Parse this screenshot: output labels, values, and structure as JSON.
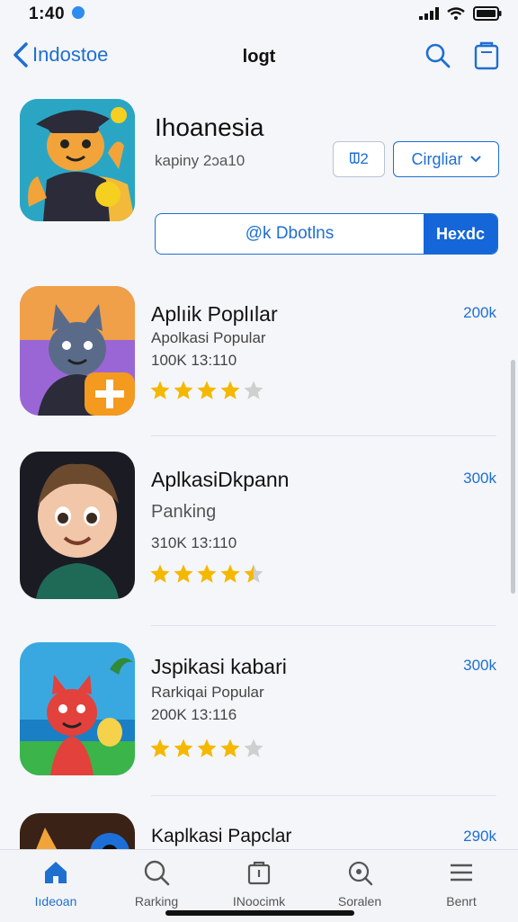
{
  "status": {
    "time": "1:40"
  },
  "nav": {
    "back_label": "Indostoe",
    "title": "loɡt"
  },
  "app": {
    "title": "Ihoanesia",
    "subtitle": "kapiny 2ɔa10",
    "small_button_label": "ᗵ2",
    "dropdown_label": "Cirgliar",
    "wide_button_left_label": "@k Dbotlns",
    "wide_button_right_label": "Hexdc"
  },
  "list": [
    {
      "name": "Aplıik Poplılar",
      "subtitle": "Apolkasi Popular",
      "meta": "100K 13:110",
      "rank": "200k",
      "rating": 4
    },
    {
      "name": "AplkasiDkpann",
      "subtitle": "Panking",
      "meta": "310K 13:110",
      "rank": "300k",
      "rating": 4.5
    },
    {
      "name": "Jspikasi kabari",
      "subtitle": "Rarkiqai Popular",
      "meta": "200K 13:116",
      "rank": "300k",
      "rating": 4
    },
    {
      "name": "Kaplkasi Papclar",
      "subtitle": "",
      "meta": "",
      "rank": "290k",
      "rating": 0
    }
  ],
  "tabs": [
    {
      "label": "Iıdeoan",
      "icon": "home-icon",
      "active": true
    },
    {
      "label": "Rarking",
      "icon": "search-icon",
      "active": false
    },
    {
      "label": "INoocimk",
      "icon": "bag-icon",
      "active": false
    },
    {
      "label": "Soralen",
      "icon": "magnifier-icon",
      "active": false
    },
    {
      "label": "Benrt",
      "icon": "menu-icon",
      "active": false
    }
  ],
  "colors": {
    "accent": "#1f6fd1",
    "accent_fill": "#1466d9",
    "star": "#f5b800",
    "star_empty": "#cfcfcf"
  }
}
